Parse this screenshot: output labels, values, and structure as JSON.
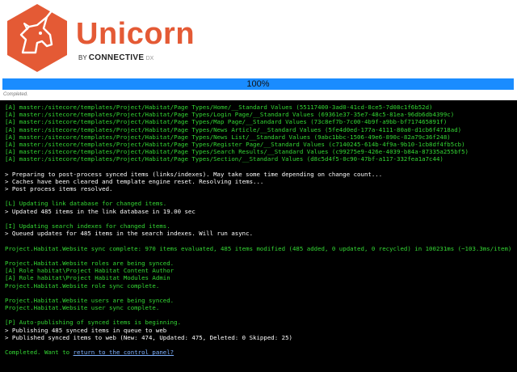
{
  "header": {
    "logo_icon": "unicorn-logo-icon",
    "brand_name": "Unicorn",
    "by_label": "BY",
    "partner": "CONNECTIVE",
    "partner_suffix": "DX",
    "accent_color": "#e45a35"
  },
  "progress": {
    "percent_text": "100%",
    "fraction": 1.0,
    "bar_color": "#1a8cff"
  },
  "status_text": "Completed.",
  "console": {
    "lines": [
      {
        "type": "green",
        "text": "[A] master:/sitecore/templates/Project/Habitat/Page Types/Home/__Standard Values (55117400-3ad0-41cd-8ce5-7d08c1f6b52d)"
      },
      {
        "type": "green",
        "text": "[A] master:/sitecore/templates/Project/Habitat/Page Types/Login Page/__Standard Values (69361e37-35e7-48c5-81ea-96db6db4399c)"
      },
      {
        "type": "green",
        "text": "[A] master:/sitecore/templates/Project/Habitat/Page Types/Map Page/__Standard Values (73c8ef7b-7c00-4b9f-a9bb-bf717465891f)"
      },
      {
        "type": "green",
        "text": "[A] master:/sitecore/templates/Project/Habitat/Page Types/News Article/__Standard Values (5fe4d0ed-177a-4111-80a0-d1cb6f4718ad)"
      },
      {
        "type": "green",
        "text": "[A] master:/sitecore/templates/Project/Habitat/Page Types/News List/__Standard Values (9abc1bbc-1506-49e6-890c-82a79c36f248)"
      },
      {
        "type": "green",
        "text": "[A] master:/sitecore/templates/Project/Habitat/Page Types/Register Page/__Standard Values (c7140245-614b-4f9a-9b10-1cb8df4fb5cb)"
      },
      {
        "type": "green",
        "text": "[A] master:/sitecore/templates/Project/Habitat/Page Types/Search Results/__Standard Values (c99275e9-426e-4039-b84a-87335a255bf5)"
      },
      {
        "type": "green",
        "text": "[A] master:/sitecore/templates/Project/Habitat/Page Types/Section/__Standard Values (d8c5d4f5-0c90-47bf-a117-332fea1a7c44)"
      },
      {
        "type": "blank",
        "text": ""
      },
      {
        "type": "white",
        "text": "> Preparing to post-process synced items (links/indexes). May take some time depending on change count..."
      },
      {
        "type": "white",
        "text": "> Caches have been cleared and template engine reset. Resolving items..."
      },
      {
        "type": "white",
        "text": "> Post process items resolved."
      },
      {
        "type": "blank",
        "text": ""
      },
      {
        "type": "green",
        "text": "[L] Updating link database for changed items."
      },
      {
        "type": "white",
        "text": "> Updated 485 items in the link database in 19.00 sec"
      },
      {
        "type": "blank",
        "text": ""
      },
      {
        "type": "green",
        "text": "[I] Updating search indexes for changed items."
      },
      {
        "type": "white",
        "text": "> Queued updates for 485 items in the search indexes. Will run async."
      },
      {
        "type": "blank",
        "text": ""
      },
      {
        "type": "green",
        "text": "Project.Habitat.Website sync complete: 970 items evaluated, 485 items modified (485 added, 0 updated, 0 recycled) in 100231ms (~103.3ms/item)."
      },
      {
        "type": "blank",
        "text": ""
      },
      {
        "type": "green",
        "text": "Project.Habitat.Website roles are being synced."
      },
      {
        "type": "green",
        "text": "[A] Role habitat\\Project Habitat Content Author"
      },
      {
        "type": "green",
        "text": "[A] Role habitat\\Project Habitat Modules Admin"
      },
      {
        "type": "green",
        "text": "Project.Habitat.Website role sync complete."
      },
      {
        "type": "blank",
        "text": ""
      },
      {
        "type": "green",
        "text": "Project.Habitat.Website users are being synced."
      },
      {
        "type": "green",
        "text": "Project.Habitat.Website user sync complete."
      },
      {
        "type": "blank",
        "text": ""
      },
      {
        "type": "green",
        "text": "[P] Auto-publishing of synced items is beginning."
      },
      {
        "type": "white",
        "text": "> Publishing 485 synced items in queue to web"
      },
      {
        "type": "white",
        "text": "> Published synced items to web (New: 474, Updated: 475, Deleted: 0 Skipped: 25)"
      },
      {
        "type": "blank",
        "text": ""
      }
    ],
    "final_prefix": "Completed. Want to ",
    "final_link": "return to the control panel?"
  }
}
